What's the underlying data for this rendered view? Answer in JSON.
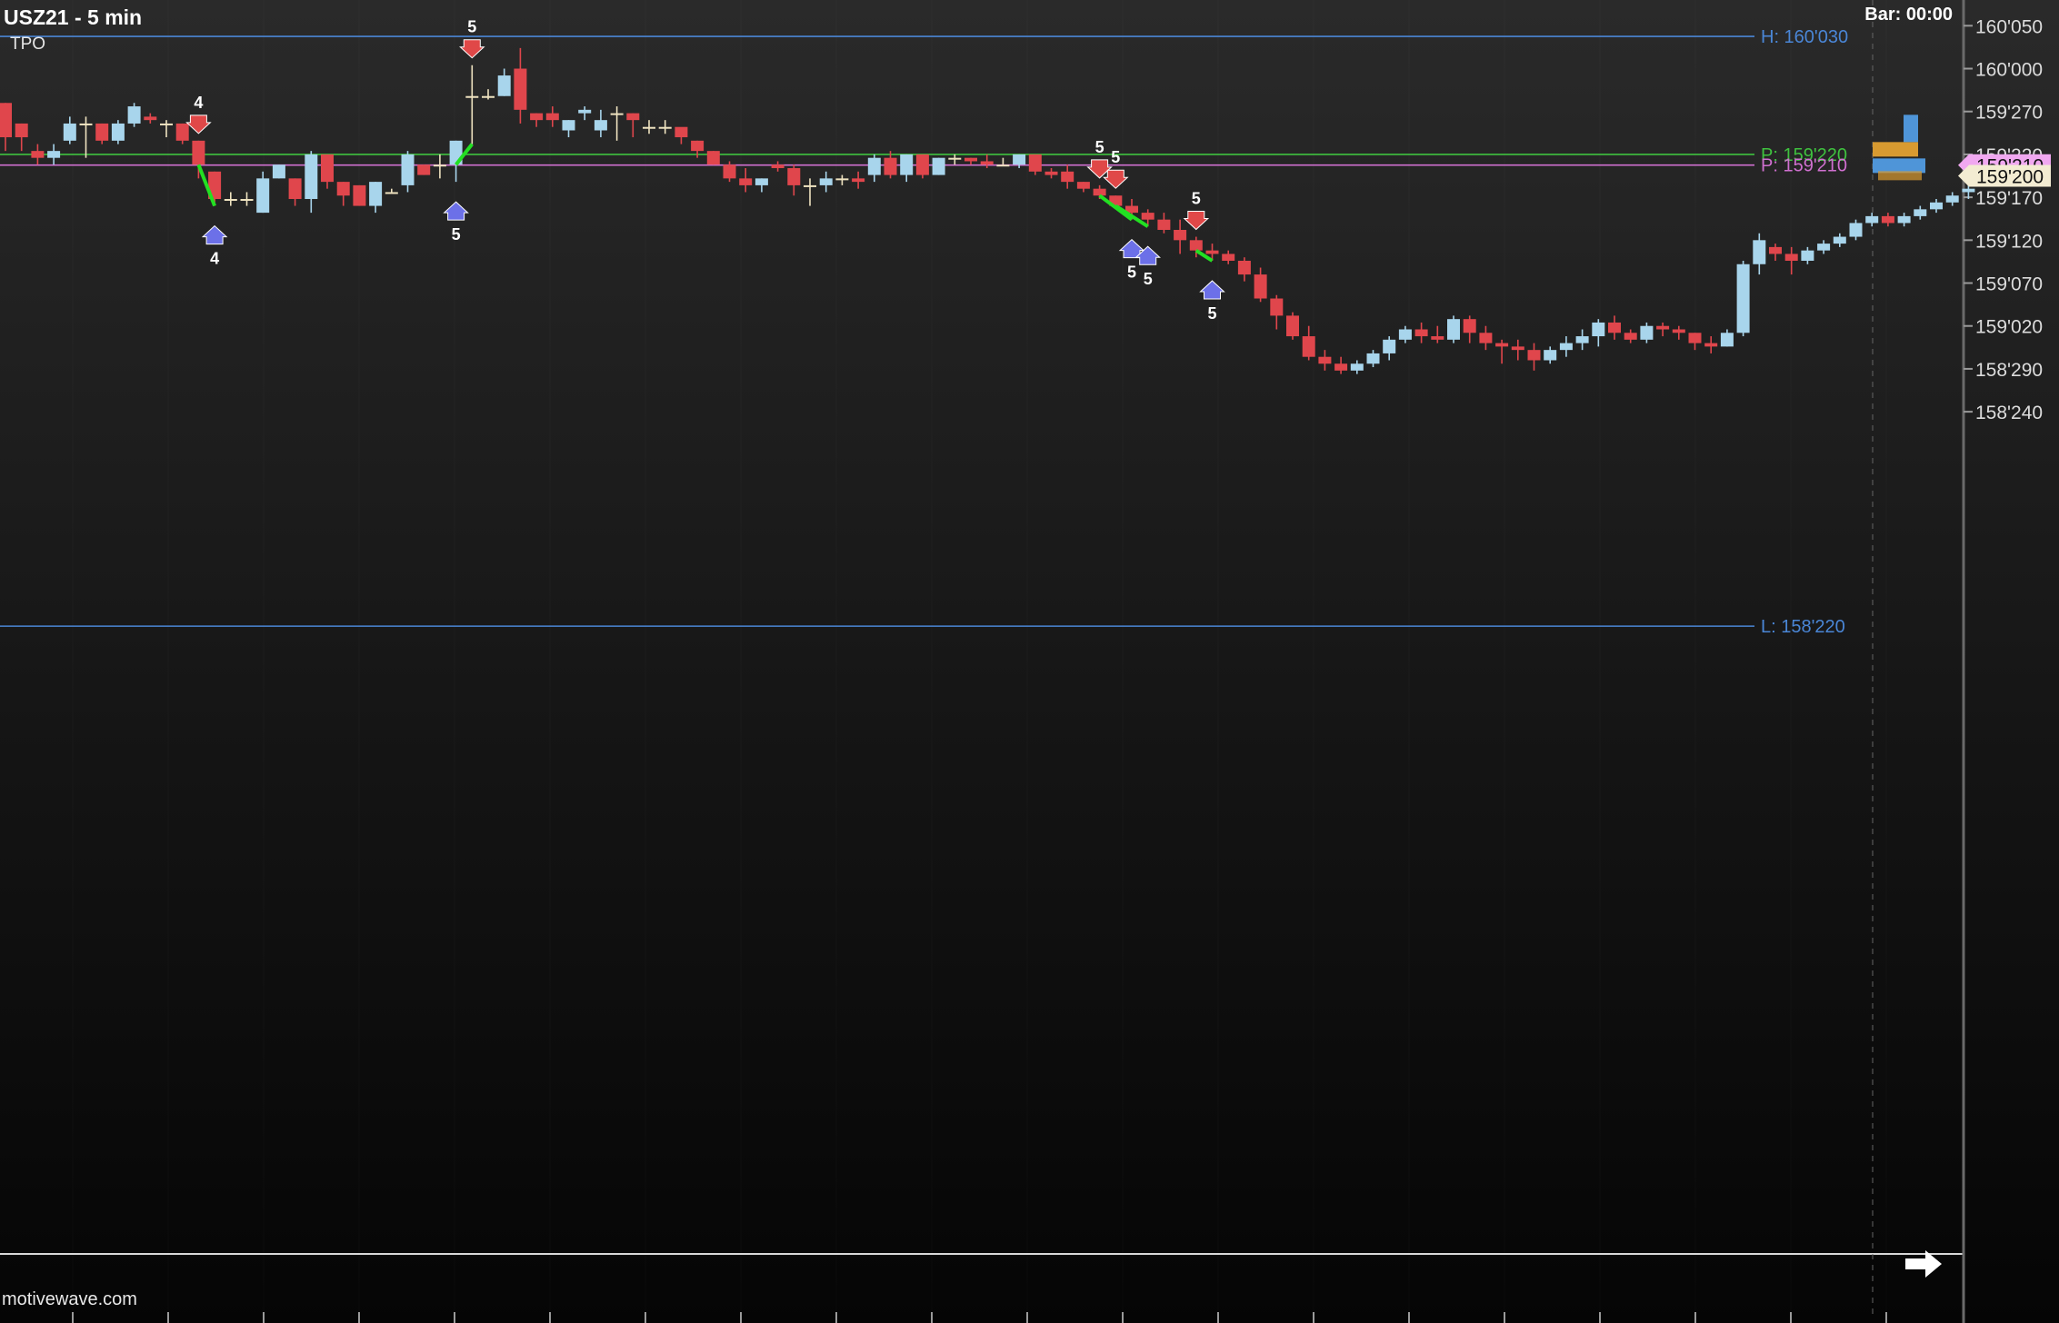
{
  "header": {
    "symbol_title": "USZ21 - 5 min",
    "study_label": "TPO",
    "bar_timer": "Bar: 00:00"
  },
  "footer": {
    "watermark": "motivewave.com"
  },
  "colors": {
    "up_candle": "#a8d5ec",
    "down_candle": "#e0464c",
    "doji": "#efe3c0",
    "high_line": "#4a86d6",
    "low_line": "#4a86d6",
    "poc_green": "#3fc23f",
    "poc_magenta": "#d070d0",
    "signal_line": "#22e022",
    "up_arrow": "#6c70e8",
    "down_arrow": "#e04848",
    "axis_text": "#dcdcdc"
  },
  "chart_data": {
    "type": "candlestick",
    "y_axis": {
      "label_format": "32nds",
      "min": 158.18,
      "max": 160.1,
      "ticks": [
        {
          "value": 160.0625,
          "label": "160'050"
        },
        {
          "value": 160.0,
          "label": "160'000"
        },
        {
          "value": 159.9375,
          "label": "159'270"
        },
        {
          "value": 159.875,
          "label": "159'220"
        },
        {
          "value": 159.8125,
          "label": "159'170"
        },
        {
          "value": 159.75,
          "label": "159'120"
        },
        {
          "value": 159.6875,
          "label": "159'070"
        },
        {
          "value": 159.625,
          "label": "159'020"
        },
        {
          "value": 159.5625,
          "label": "158'290"
        },
        {
          "value": 159.5,
          "label": "158'240"
        }
      ]
    },
    "reference_lines": [
      {
        "id": "high",
        "label": "H: 160'030",
        "value": 160.0469,
        "color": "#4a86d6"
      },
      {
        "id": "poc1",
        "label": "P: 159'220",
        "value": 159.875,
        "color": "#3fc23f"
      },
      {
        "id": "poc2",
        "label": "P: 159'210",
        "value": 159.8594,
        "color": "#d070d0"
      },
      {
        "id": "low",
        "label": "L: 158'220",
        "value": 159.1875,
        "color": "#4a86d6"
      }
    ],
    "price_tags": [
      {
        "label": "159'210",
        "value": 159.8594,
        "style": "magenta"
      },
      {
        "label": "159'200",
        "value": 159.8438,
        "style": "cream"
      }
    ],
    "candles": [
      [
        159.95,
        159.95,
        159.88,
        159.9
      ],
      [
        159.92,
        159.92,
        159.88,
        159.9
      ],
      [
        159.88,
        159.89,
        159.86,
        159.87
      ],
      [
        159.87,
        159.89,
        159.86,
        159.88
      ],
      [
        159.895,
        159.93,
        159.89,
        159.92
      ],
      [
        159.92,
        159.93,
        159.87,
        159.92
      ],
      [
        159.92,
        159.92,
        159.89,
        159.895
      ],
      [
        159.895,
        159.925,
        159.89,
        159.92
      ],
      [
        159.92,
        159.95,
        159.915,
        159.945
      ],
      [
        159.93,
        159.935,
        159.92,
        159.925
      ],
      [
        159.92,
        159.925,
        159.9,
        159.92
      ],
      [
        159.92,
        159.92,
        159.89,
        159.895
      ],
      [
        159.895,
        159.895,
        159.84,
        159.86
      ],
      [
        159.85,
        159.85,
        159.8,
        159.81
      ],
      [
        159.81,
        159.82,
        159.8,
        159.81
      ],
      [
        159.81,
        159.82,
        159.8,
        159.81
      ],
      [
        159.79,
        159.85,
        159.79,
        159.84
      ],
      [
        159.84,
        159.86,
        159.84,
        159.86
      ],
      [
        159.84,
        159.84,
        159.8,
        159.81
      ],
      [
        159.81,
        159.88,
        159.79,
        159.875
      ],
      [
        159.875,
        159.875,
        159.825,
        159.835
      ],
      [
        159.835,
        159.835,
        159.8,
        159.815
      ],
      [
        159.83,
        159.83,
        159.8,
        159.8
      ],
      [
        159.8,
        159.835,
        159.79,
        159.835
      ],
      [
        159.82,
        159.825,
        159.82,
        159.82
      ],
      [
        159.83,
        159.88,
        159.82,
        159.875
      ],
      [
        159.86,
        159.86,
        159.845,
        159.845
      ],
      [
        159.86,
        159.875,
        159.84,
        159.86
      ],
      [
        159.86,
        159.895,
        159.835,
        159.895
      ],
      [
        159.96,
        160.005,
        159.89,
        159.96
      ],
      [
        159.96,
        159.97,
        159.955,
        159.96
      ],
      [
        159.96,
        160.0,
        159.96,
        159.99
      ],
      [
        160.0,
        160.03,
        159.92,
        159.94
      ],
      [
        159.935,
        159.935,
        159.915,
        159.925
      ],
      [
        159.935,
        159.945,
        159.915,
        159.925
      ],
      [
        159.91,
        159.925,
        159.9,
        159.925
      ],
      [
        159.935,
        159.945,
        159.925,
        159.94
      ],
      [
        159.91,
        159.94,
        159.9,
        159.925
      ],
      [
        159.935,
        159.945,
        159.895,
        159.935
      ],
      [
        159.935,
        159.935,
        159.9,
        159.925
      ],
      [
        159.915,
        159.925,
        159.905,
        159.915
      ],
      [
        159.915,
        159.925,
        159.905,
        159.915
      ],
      [
        159.915,
        159.91,
        159.89,
        159.9
      ],
      [
        159.895,
        159.895,
        159.87,
        159.88
      ],
      [
        159.88,
        159.88,
        159.86,
        159.86
      ],
      [
        159.86,
        159.865,
        159.835,
        159.84
      ],
      [
        159.84,
        159.855,
        159.82,
        159.83
      ],
      [
        159.83,
        159.84,
        159.82,
        159.84
      ],
      [
        159.86,
        159.865,
        159.85,
        159.855
      ],
      [
        159.855,
        159.86,
        159.815,
        159.83
      ],
      [
        159.83,
        159.84,
        159.8,
        159.83
      ],
      [
        159.83,
        159.85,
        159.82,
        159.84
      ],
      [
        159.84,
        159.845,
        159.83,
        159.84
      ],
      [
        159.84,
        159.85,
        159.825,
        159.835
      ],
      [
        159.845,
        159.875,
        159.835,
        159.87
      ],
      [
        159.87,
        159.88,
        159.84,
        159.845
      ],
      [
        159.845,
        159.875,
        159.835,
        159.875
      ],
      [
        159.875,
        159.875,
        159.84,
        159.845
      ],
      [
        159.845,
        159.87,
        159.845,
        159.87
      ],
      [
        159.87,
        159.875,
        159.86,
        159.87
      ],
      [
        159.87,
        159.87,
        159.86,
        159.865
      ],
      [
        159.865,
        159.875,
        159.855,
        159.86
      ],
      [
        159.86,
        159.87,
        159.86,
        159.86
      ],
      [
        159.86,
        159.875,
        159.855,
        159.875
      ],
      [
        159.875,
        159.875,
        159.845,
        159.85
      ],
      [
        159.85,
        159.855,
        159.84,
        159.845
      ],
      [
        159.85,
        159.86,
        159.825,
        159.835
      ],
      [
        159.835,
        159.835,
        159.82,
        159.825
      ],
      [
        159.825,
        159.83,
        159.81,
        159.815
      ],
      [
        159.815,
        159.815,
        159.8,
        159.8
      ],
      [
        159.8,
        159.81,
        159.78,
        159.79
      ],
      [
        159.79,
        159.795,
        159.77,
        159.78
      ],
      [
        159.78,
        159.79,
        159.76,
        159.765
      ],
      [
        159.765,
        159.78,
        159.73,
        159.75
      ],
      [
        159.75,
        159.755,
        159.725,
        159.735
      ],
      [
        159.735,
        159.745,
        159.72,
        159.73
      ],
      [
        159.73,
        159.735,
        159.715,
        159.72
      ],
      [
        159.72,
        159.725,
        159.69,
        159.7
      ],
      [
        159.7,
        159.71,
        159.66,
        159.665
      ],
      [
        159.665,
        159.67,
        159.62,
        159.64
      ],
      [
        159.64,
        159.645,
        159.605,
        159.61
      ],
      [
        159.61,
        159.625,
        159.575,
        159.58
      ],
      [
        159.58,
        159.59,
        159.56,
        159.57
      ],
      [
        159.57,
        159.58,
        159.555,
        159.56
      ],
      [
        159.56,
        159.575,
        159.555,
        159.57
      ],
      [
        159.57,
        159.59,
        159.565,
        159.585
      ],
      [
        159.585,
        159.61,
        159.575,
        159.605
      ],
      [
        159.605,
        159.625,
        159.6,
        159.62
      ],
      [
        159.62,
        159.63,
        159.6,
        159.61
      ],
      [
        159.61,
        159.625,
        159.6,
        159.605
      ],
      [
        159.605,
        159.64,
        159.6,
        159.635
      ],
      [
        159.635,
        159.64,
        159.6,
        159.615
      ],
      [
        159.615,
        159.625,
        159.59,
        159.6
      ],
      [
        159.6,
        159.605,
        159.57,
        159.595
      ],
      [
        159.595,
        159.605,
        159.575,
        159.59
      ],
      [
        159.59,
        159.6,
        159.56,
        159.575
      ],
      [
        159.575,
        159.595,
        159.57,
        159.59
      ],
      [
        159.59,
        159.61,
        159.58,
        159.6
      ],
      [
        159.6,
        159.62,
        159.59,
        159.61
      ],
      [
        159.61,
        159.635,
        159.595,
        159.63
      ],
      [
        159.63,
        159.64,
        159.605,
        159.615
      ],
      [
        159.615,
        159.62,
        159.6,
        159.605
      ],
      [
        159.605,
        159.63,
        159.6,
        159.625
      ],
      [
        159.625,
        159.63,
        159.61,
        159.62
      ],
      [
        159.62,
        159.625,
        159.605,
        159.615
      ],
      [
        159.615,
        159.615,
        159.59,
        159.6
      ],
      [
        159.6,
        159.61,
        159.585,
        159.595
      ],
      [
        159.595,
        159.62,
        159.595,
        159.615
      ],
      [
        159.615,
        159.72,
        159.61,
        159.715
      ],
      [
        159.715,
        159.76,
        159.7,
        159.75
      ],
      [
        159.74,
        159.745,
        159.72,
        159.73
      ],
      [
        159.73,
        159.74,
        159.7,
        159.72
      ],
      [
        159.72,
        159.74,
        159.715,
        159.735
      ],
      [
        159.735,
        159.75,
        159.73,
        159.745
      ],
      [
        159.745,
        159.76,
        159.74,
        159.755
      ],
      [
        159.755,
        159.78,
        159.75,
        159.775
      ],
      [
        159.775,
        159.79,
        159.77,
        159.785
      ],
      [
        159.785,
        159.79,
        159.77,
        159.775
      ],
      [
        159.775,
        159.79,
        159.77,
        159.785
      ],
      [
        159.785,
        159.8,
        159.78,
        159.795
      ],
      [
        159.795,
        159.81,
        159.79,
        159.805
      ],
      [
        159.805,
        159.82,
        159.8,
        159.815
      ],
      [
        159.82,
        159.83,
        159.81,
        159.825
      ],
      [
        159.84,
        159.85,
        159.83,
        159.845
      ]
    ],
    "signals": [
      {
        "bar": 12,
        "type": "down",
        "count": "4"
      },
      {
        "bar": 13,
        "type": "up",
        "count": "4"
      },
      {
        "bar": 28,
        "type": "up",
        "count": "5"
      },
      {
        "bar": 29,
        "type": "down",
        "count": "5"
      },
      {
        "bar": 68,
        "type": "down",
        "count": "5"
      },
      {
        "bar": 69,
        "type": "down",
        "count": "5"
      },
      {
        "bar": 70,
        "type": "up",
        "count": "5"
      },
      {
        "bar": 71,
        "type": "up",
        "count": "5"
      },
      {
        "bar": 74,
        "type": "down",
        "count": "5"
      },
      {
        "bar": 75,
        "type": "up",
        "count": "5"
      }
    ]
  }
}
